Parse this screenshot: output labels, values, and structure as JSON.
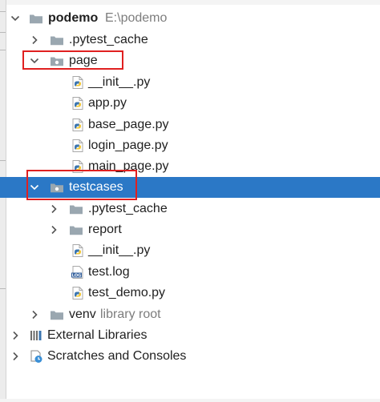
{
  "project": {
    "name": "podemo",
    "path": "E:\\podemo",
    "pytest_cache": ".pytest_cache",
    "page": {
      "name": "page",
      "files": [
        "__init__.py",
        "app.py",
        "base_page.py",
        "login_page.py",
        "main_page.py"
      ]
    },
    "testcases": {
      "name": "testcases",
      "pytest_cache": ".pytest_cache",
      "report": "report",
      "init": "__init__.py",
      "log": "test.log",
      "demo": "test_demo.py"
    },
    "venv": {
      "name": "venv",
      "note": "library root"
    }
  },
  "external_libraries": "External Libraries",
  "scratches": "Scratches and Consoles",
  "icons": {
    "folder": "folder-icon",
    "python_file": "python-file-icon",
    "log_file": "log-file-icon",
    "libraries": "libraries-icon",
    "scratches": "scratches-icon"
  },
  "colors": {
    "selection": "#2b78c6",
    "highlight_box": "#e02020",
    "folder": "#9aa7b0"
  }
}
